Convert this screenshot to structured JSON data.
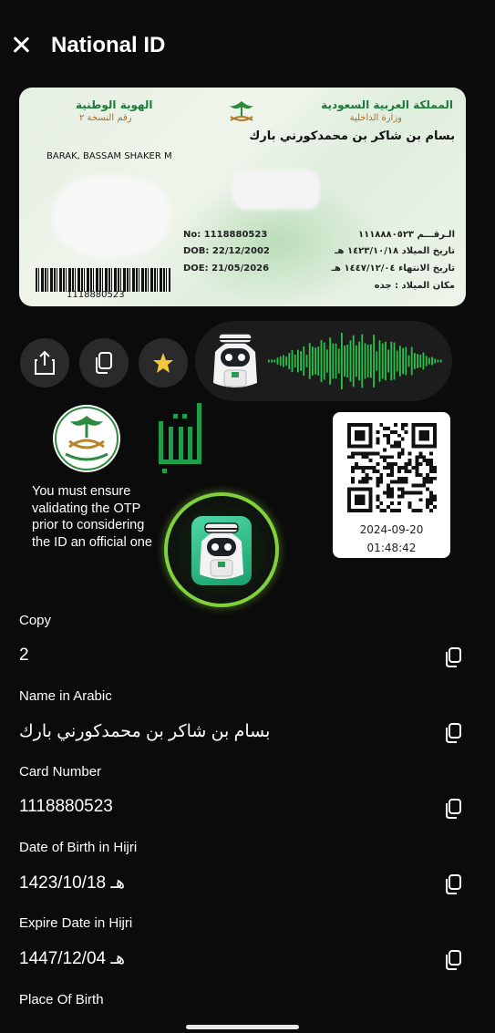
{
  "header": {
    "title": "National ID",
    "close_icon": "close-icon"
  },
  "card": {
    "ar_title_left": "الهوية الوطنية",
    "ar_sub_left": "رقم النسخة ٢",
    "ar_title_right": "المملكة العربية السعودية",
    "ar_sub_right": "وزارة الداخلية",
    "ar_name": "بسام بن شاكر بن محمدكورني بارك",
    "en_name": "BARAK, BASSAM SHAKER M",
    "no_label": "No: 1118880523",
    "dob_label": "DOB: 22/12/2002",
    "doe_label": "DOE: 21/05/2026",
    "ar_no": "الـرقـــم ١١١٨٨٨٠٥٢٣",
    "ar_dob": "تاريخ الميلاد ١٤٢٣/١٠/١٨ هـ",
    "ar_doe": "تاريخ الانتهاء ١٤٤٧/١٢/٠٤ هـ",
    "ar_pob": "مكان الميلاد : جده",
    "barcode_number": "1118880523"
  },
  "actions": [
    {
      "name": "share-button",
      "icon": "share-icon"
    },
    {
      "name": "copy-button",
      "icon": "copy-icon"
    },
    {
      "name": "favorite-button",
      "icon": "star-icon"
    }
  ],
  "verification": {
    "notice": "You must ensure validating the OTP prior to considering the ID an official one",
    "qr_date": "2024-09-20",
    "qr_time": "01:48:42"
  },
  "fields": [
    {
      "label": "Copy",
      "value": "2"
    },
    {
      "label": "Name in Arabic",
      "value": "بسام بن شاكر بن محمدكورني بارك"
    },
    {
      "label": "Card Number",
      "value": "1118880523"
    },
    {
      "label": "Date of Birth in Hijri",
      "value": "1423/10/18 هـ"
    },
    {
      "label": "Expire Date in Hijri",
      "value": "1447/12/04 هـ"
    },
    {
      "label": "Place Of Birth",
      "value": ""
    }
  ],
  "colors": {
    "accent_green": "#7fd23a",
    "absher_green": "#1e9e4a",
    "background": "#0b0b0b"
  }
}
